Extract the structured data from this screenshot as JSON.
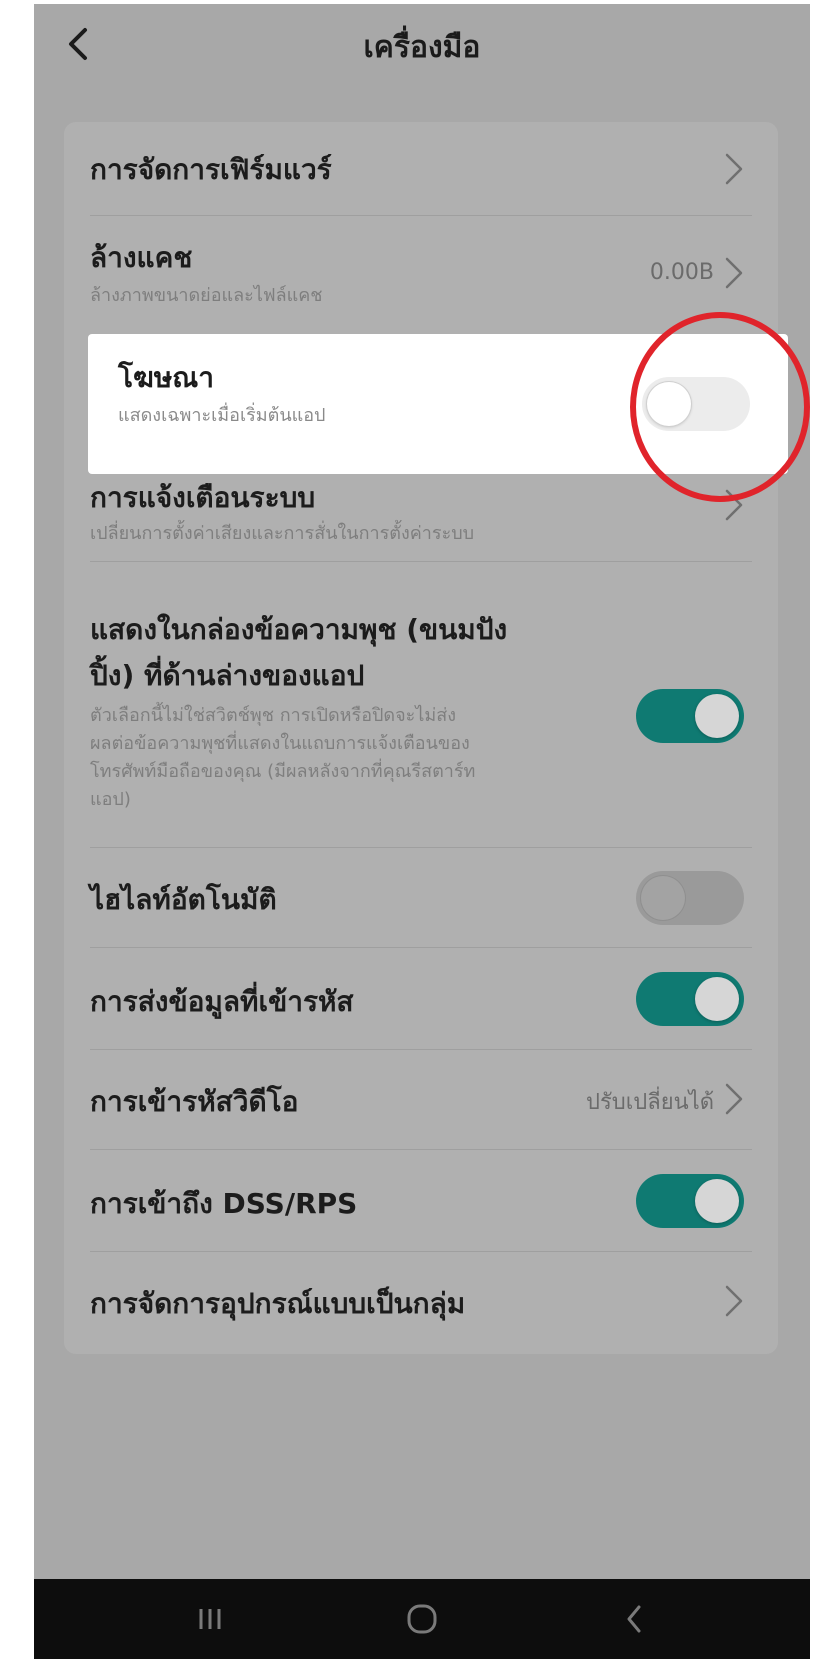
{
  "header": {
    "title": "เครื่องมือ"
  },
  "settings": {
    "firmware": {
      "title": "การจัดการเฟิร์มแวร์"
    },
    "cache": {
      "title": "ล้างแคช",
      "subtitle": "ล้างภาพขนาดย่อและไฟล์แคช",
      "value": "0.00B"
    },
    "ads": {
      "title": "โฆษณา",
      "subtitle": "แสดงเฉพาะเมื่อเริ่มต้นแอป",
      "toggle_on": false
    },
    "system_notify": {
      "title": "การแจ้งเตือนระบบ",
      "subtitle": "เปลี่ยนการตั้งค่าเสียงและการสั่นในการตั้งค่าระบบ"
    },
    "push_inbox": {
      "title_line1": "แสดงในกล่องข้อความพุช (ขนมปัง",
      "title_line2": "ปิ้ง) ที่ด้านล่างของแอป",
      "desc_line1": "ตัวเลือกนี้ไม่ใช่สวิตช์พุช การเปิดหรือปิดจะไม่ส่ง",
      "desc_line2": "ผลต่อข้อความพุชที่แสดงในแถบการแจ้งเตือนของ",
      "desc_line3": "โทรศัพท์มือถือของคุณ (มีผลหลังจากที่คุณรีสตาร์ท",
      "desc_line4": "แอป)",
      "toggle_on": true
    },
    "auto_highlight": {
      "title": "ไฮไลท์อัตโนมัติ",
      "toggle_on": false
    },
    "encrypted_transfer": {
      "title": "การส่งข้อมูลที่เข้ารหัส",
      "toggle_on": true
    },
    "video_encoding": {
      "title": "การเข้ารหัสวิดีโอ",
      "value": "ปรับเปลี่ยนได้"
    },
    "dss_rps": {
      "title": "การเข้าถึง DSS/RPS",
      "toggle_on": true
    },
    "group_devices": {
      "title": "การจัดการอุปกรณ์แบบเป็นกลุ่ม"
    }
  },
  "navbar": {
    "recents_icon": "recents-icon",
    "home_icon": "home-icon",
    "back_icon": "back-icon"
  },
  "colors": {
    "toggle_on": "#0f7a72",
    "annotation": "#e0242b"
  }
}
